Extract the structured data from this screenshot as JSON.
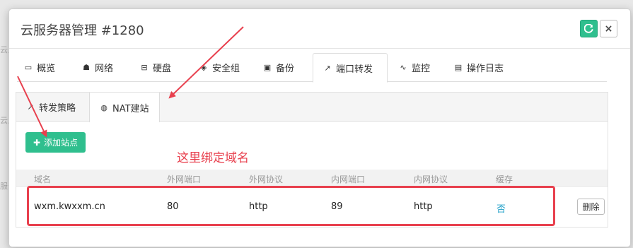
{
  "background": {
    "hints": [
      "云服",
      "云服",
      "服务"
    ]
  },
  "modal": {
    "title": "云服务器管理 #1280",
    "refresh_icon": "refresh-icon",
    "close_label": "×"
  },
  "main_tabs": [
    {
      "label": "概览",
      "icon": "monitor-icon",
      "glyph": "▭"
    },
    {
      "label": "网络",
      "icon": "sitemap-icon",
      "glyph": "☗"
    },
    {
      "label": "硬盘",
      "icon": "hdd-icon",
      "glyph": "⊟"
    },
    {
      "label": "安全组",
      "icon": "shield-icon",
      "glyph": "◈"
    },
    {
      "label": "备份",
      "icon": "save-icon",
      "glyph": "▣"
    },
    {
      "label": "端口转发",
      "icon": "external-link-icon",
      "glyph": "↗"
    },
    {
      "label": "监控",
      "icon": "pulse-icon",
      "glyph": "∿"
    },
    {
      "label": "操作日志",
      "icon": "file-icon",
      "glyph": "▤"
    }
  ],
  "sub_tabs": [
    {
      "label": "转发策略",
      "icon": "external-link-icon",
      "glyph": "↗"
    },
    {
      "label": "NAT建站",
      "icon": "globe-icon",
      "glyph": "◍"
    }
  ],
  "add_button": {
    "label": "添加站点",
    "glyph": "✚"
  },
  "annotation": {
    "text": "这里绑定域名"
  },
  "table": {
    "headers": [
      "域名",
      "外网端口",
      "外网协议",
      "内网端口",
      "内网协议",
      "缓存"
    ],
    "row": {
      "domain": "wxm.kwxxm.cn",
      "ext_port": "80",
      "ext_protocol": "http",
      "int_port": "89",
      "int_protocol": "http",
      "cache": "否",
      "action": "删除"
    }
  },
  "colors": {
    "accent": "#2fbf8e",
    "annotation": "#e8404e",
    "link": "#20a0c8"
  }
}
